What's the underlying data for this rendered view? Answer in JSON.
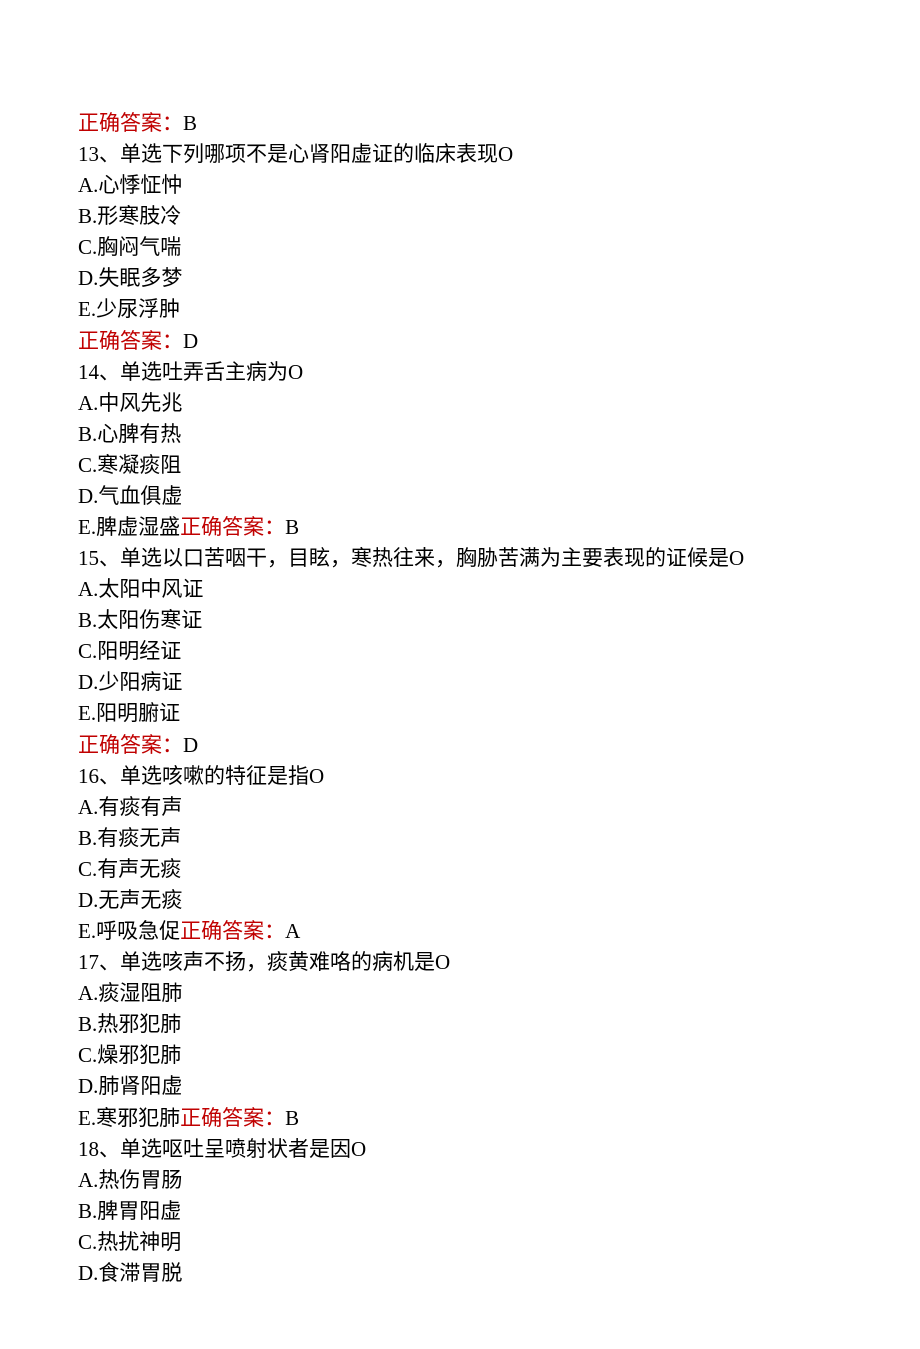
{
  "labels": {
    "correct_answer": "正确答案："
  },
  "questions": [
    {
      "pre_answer": "B",
      "num": "13",
      "stem": "、单选下列哪项不是心肾阳虚证的临床表现O",
      "options": [
        {
          "letter": "A",
          "text": ".心悸怔忡"
        },
        {
          "letter": "B",
          "text": ".形寒肢冷"
        },
        {
          "letter": "C",
          "text": ".胸闷气喘"
        },
        {
          "letter": "D",
          "text": ".失眠多梦"
        },
        {
          "letter": "E",
          "text": ".少尿浮肿"
        }
      ],
      "inline_answer": null,
      "answer": "D"
    },
    {
      "pre_answer": null,
      "num": "14",
      "stem": "、单选吐弄舌主病为O",
      "options": [
        {
          "letter": "A",
          "text": ".中风先兆"
        },
        {
          "letter": "B",
          "text": ".心脾有热"
        },
        {
          "letter": "C",
          "text": ".寒凝痰阻"
        },
        {
          "letter": "D",
          "text": ".气血俱虚"
        },
        {
          "letter": "E",
          "text": ".脾虚湿盛"
        }
      ],
      "inline_answer": "B",
      "answer": null
    },
    {
      "pre_answer": null,
      "num": "15",
      "stem": "、单选以口苦咽干，目眩，寒热往来，胸胁苦满为主要表现的证候是O",
      "options": [
        {
          "letter": "A",
          "text": ".太阳中风证"
        },
        {
          "letter": "B",
          "text": ".太阳伤寒证"
        },
        {
          "letter": "C",
          "text": ".阳明经证"
        },
        {
          "letter": "D",
          "text": ".少阳病证"
        },
        {
          "letter": "E",
          "text": ".阳明腑证"
        }
      ],
      "inline_answer": null,
      "answer": "D"
    },
    {
      "pre_answer": null,
      "num": "16",
      "stem": "、单选咳嗽的特征是指O",
      "options": [
        {
          "letter": "A",
          "text": ".有痰有声"
        },
        {
          "letter": "B",
          "text": ".有痰无声"
        },
        {
          "letter": "C",
          "text": ".有声无痰"
        },
        {
          "letter": "D",
          "text": ".无声无痰"
        },
        {
          "letter": "E",
          "text": ".呼吸急促"
        }
      ],
      "inline_answer": "A",
      "answer": null
    },
    {
      "pre_answer": null,
      "num": "17",
      "stem": "、单选咳声不扬，痰黄难咯的病机是O",
      "options": [
        {
          "letter": "A",
          "text": ".痰湿阻肺"
        },
        {
          "letter": "B",
          "text": ".热邪犯肺"
        },
        {
          "letter": "C",
          "text": ".燥邪犯肺"
        },
        {
          "letter": "D",
          "text": ".肺肾阳虚"
        },
        {
          "letter": "E",
          "text": ".寒邪犯肺"
        }
      ],
      "inline_answer": "B",
      "answer": null
    },
    {
      "pre_answer": null,
      "num": "18",
      "stem": "、单选呕吐呈喷射状者是因O",
      "options": [
        {
          "letter": "A",
          "text": ".热伤胃肠"
        },
        {
          "letter": "B",
          "text": ".脾胃阳虚"
        },
        {
          "letter": "C",
          "text": ".热扰神明"
        },
        {
          "letter": "D",
          "text": ".食滞胃脱"
        }
      ],
      "inline_answer": null,
      "answer": null
    }
  ]
}
